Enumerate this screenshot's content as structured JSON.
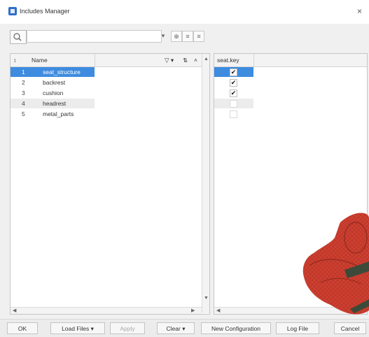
{
  "window": {
    "title": "Includes Manager",
    "close_label": "×"
  },
  "toolbar": {
    "search_value": "",
    "dropdown_arrow": "▾",
    "buttons": [
      "⊕",
      "≡",
      "≡"
    ]
  },
  "left_panel": {
    "headers": {
      "icon": "↕",
      "name": "Name",
      "filter_btn": "▽ ▾",
      "sort_btn": "⇅",
      "more_btn": "˄"
    },
    "rows": [
      {
        "num": "1",
        "name": "seat_structure",
        "selected": true
      },
      {
        "num": "2",
        "name": "backrest"
      },
      {
        "num": "3",
        "name": "cushion"
      },
      {
        "num": "4",
        "name": "headrest"
      },
      {
        "num": "5",
        "name": "metal_parts"
      }
    ],
    "scroll": {
      "up": "▲",
      "down": "▼",
      "left": "◀",
      "right": "▶"
    }
  },
  "right_panel": {
    "header": "seat.key",
    "checks": [
      true,
      true,
      true,
      false,
      false
    ],
    "scroll": {
      "left": "◀",
      "right": "▶"
    }
  },
  "bottom": {
    "ok": "OK",
    "load_files": "Load Files ▾",
    "apply": "Apply",
    "clear": "Clear ▾",
    "new_configuration": "New Configuration",
    "log_file": "Log File",
    "cancel": "Cancel"
  },
  "colors": {
    "selection": "#3d8ce0",
    "model": "#c0392b",
    "model_edge": "#e34a3a"
  },
  "icons": {
    "search": "search-icon",
    "window": "app-icon",
    "close": "close-icon"
  }
}
